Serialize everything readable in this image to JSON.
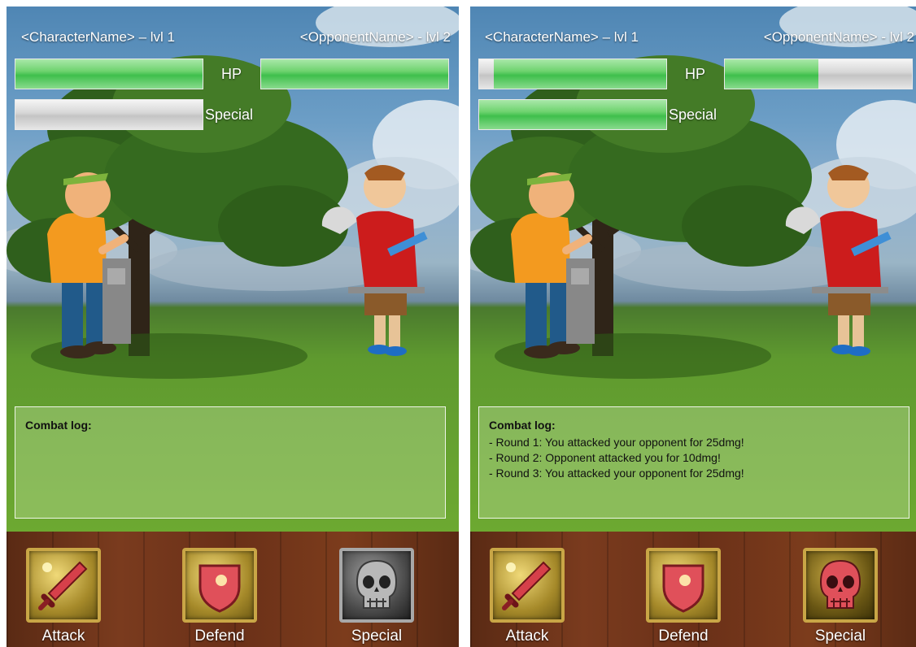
{
  "screens": [
    {
      "character_name": "<CharacterName> – lvl 1",
      "opponent_name": "<OpponentName> - lvl 2",
      "hp_label": "HP",
      "special_label": "Special",
      "player_hp_fraction": 1.0,
      "opponent_hp_fraction": 1.0,
      "special_fraction": 0.0,
      "combat_log": {
        "title": "Combat log:",
        "entries": []
      },
      "actions": [
        {
          "label": "Attack",
          "icon": "sword-icon"
        },
        {
          "label": "Defend",
          "icon": "shield-icon"
        },
        {
          "label": "Special",
          "icon": "skull-icon",
          "state": "disabled"
        }
      ]
    },
    {
      "character_name": "<CharacterName> – lvl 1",
      "opponent_name": "<OpponentName> - lvl 2",
      "hp_label": "HP",
      "special_label": "Special",
      "player_hp_fraction": 0.92,
      "opponent_hp_fraction": 0.5,
      "special_fraction": 1.0,
      "combat_log": {
        "title": "Combat log:",
        "entries": [
          "- Round 1: You attacked your opponent for 25dmg!",
          "- Round 2: Opponent attacked you for 10dmg!",
          "- Round 3: You attacked your opponent for 25dmg!"
        ]
      },
      "actions": [
        {
          "label": "Attack",
          "icon": "sword-icon"
        },
        {
          "label": "Defend",
          "icon": "shield-icon"
        },
        {
          "label": "Special",
          "icon": "skull-icon",
          "state": "enabled"
        }
      ]
    }
  ],
  "colors": {
    "hp_green": "#3fbf4c",
    "bar_empty": "#c4c4c4",
    "skull_active": "#e0505a",
    "skull_inactive": "#b8b8b8",
    "wood": "#6a3018"
  }
}
